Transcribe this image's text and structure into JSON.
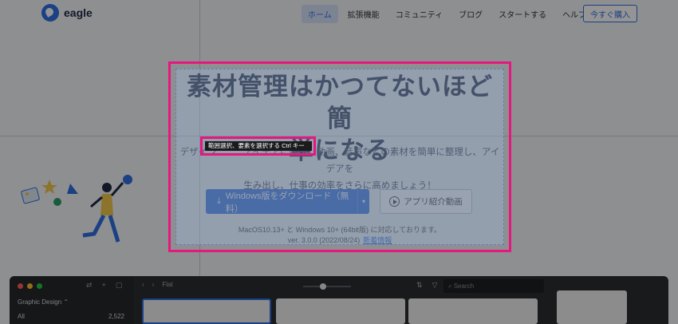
{
  "nav": {
    "brand": "eagle",
    "items": [
      {
        "label": "ホーム",
        "active": true
      },
      {
        "label": "拡張機能",
        "active": false
      },
      {
        "label": "コミュニティ",
        "active": false
      },
      {
        "label": "ブログ",
        "active": false
      },
      {
        "label": "スタートする",
        "active": false
      },
      {
        "label": "ヘルプセンター",
        "active": false
      }
    ],
    "buy_label": "今すぐ購入"
  },
  "hero": {
    "title_line1": "素材管理はかつてないほど簡",
    "title_line2": "単になる",
    "subtitle_line1": "デザイン、…、アイデアに画像、動画、音声などの素材を簡単に整理し、アイデアを",
    "subtitle_line2": "生み出し、仕事の効率をさらに高めましょう！",
    "download_label": "Windows版をダウンロード（無料）",
    "video_label": "アプリ紹介動画",
    "compat_text": "MacOS10.13+ と Windows 10+ (64bit版) に対応しております。",
    "version_text": "ver. 3.0.0 (2022/08/24)",
    "release_notes_label": "新着情報"
  },
  "tooltip": {
    "text": "範囲選択、要素を選択する Ctrl キー"
  },
  "app_preview": {
    "library_name": "Graphic Design ⌃",
    "all_label": "All",
    "all_count": "2,522",
    "folder_label": "Flat",
    "search_placeholder": "Search"
  },
  "colors": {
    "accent": "#2f6fe4",
    "selection": "#e6177f"
  }
}
